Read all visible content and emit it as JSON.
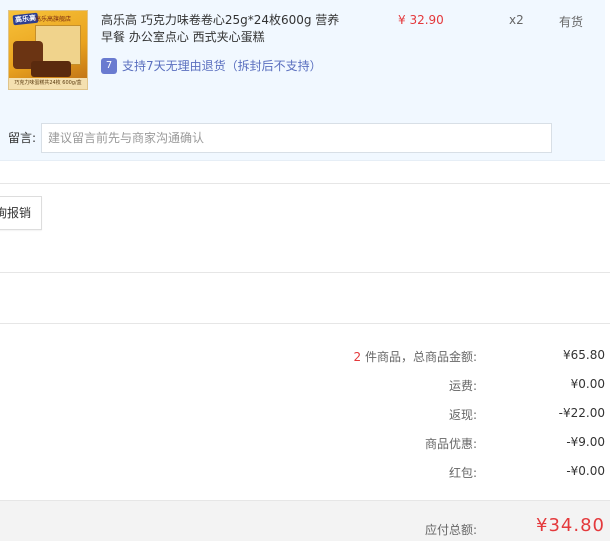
{
  "item": {
    "thumb": {
      "brand_badge": "高乐高",
      "store_label": "高乐高旗舰店",
      "caption": "巧克力味蛋糕共24枚 600g/盒"
    },
    "name": "高乐高 巧克力味卷卷心25g*24枚600g 营养早餐 办公室点心 西式夹心蛋糕",
    "price": "¥ 32.90",
    "quantity": "x2",
    "stock_status": "有货",
    "return_badge": "7",
    "return_policy": "支持7天无理由退货（拆封后不支持）",
    "remark_label": "留言:",
    "remark_placeholder": "建议留言前先与商家沟通确认"
  },
  "actions": {
    "report_label": "询报销"
  },
  "summary": {
    "item_count": "2",
    "goods_total_label": "件商品，总商品金额:",
    "goods_total_value": "¥65.80",
    "shipping_label": "运费:",
    "shipping_value": "¥0.00",
    "cashback_label": "返现:",
    "cashback_value": "-¥22.00",
    "discount_label": "商品优惠:",
    "discount_value": "-¥9.00",
    "redpacket_label": "红包:",
    "redpacket_value": "-¥0.00",
    "total_label": "应付总额:",
    "total_value": "¥34.80"
  },
  "colors": {
    "accent_red": "#e4393c",
    "item_bg": "#f1f8ff",
    "link_blue": "#5a6fbf"
  }
}
